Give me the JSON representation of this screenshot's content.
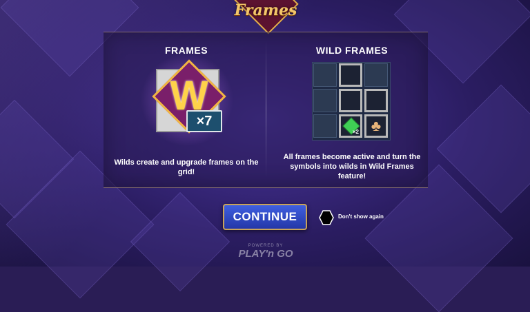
{
  "logo": {
    "text": "Frames"
  },
  "left_panel": {
    "heading": "FRAMES",
    "multiplier": "×7",
    "icon_letter": "W",
    "description": "Wilds create and upgrade frames on the grid!"
  },
  "right_panel": {
    "heading": "WILD FRAMES",
    "description": "All frames become active and turn the symbols into wilds in Wild Frames feature!",
    "grid_multiplier": "×2"
  },
  "footer": {
    "continue_label": "CONTINUE",
    "dont_show_label": "Don't show again",
    "powered_by": "POWERED BY",
    "brand": "PLAY'n GO"
  },
  "colors": {
    "accent_gold": "#e2b04a",
    "button_blue": "#2f48c8",
    "background": "#2a1d55"
  }
}
